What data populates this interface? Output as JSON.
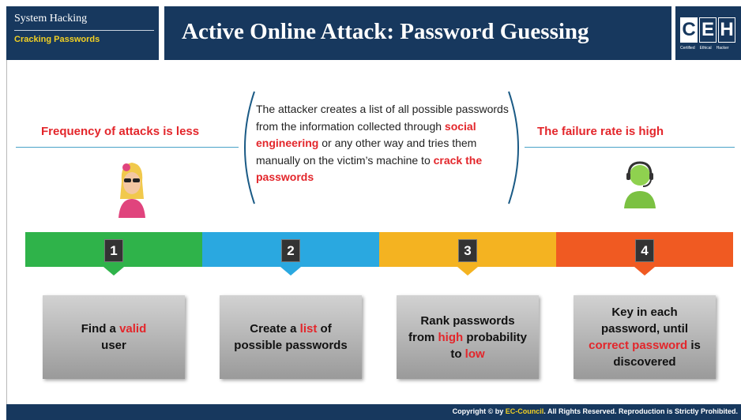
{
  "header": {
    "section": "System Hacking",
    "subsection": "Cracking Passwords",
    "title": "Active Online Attack: Password Guessing",
    "logo": {
      "letters": [
        "C",
        "E",
        "H"
      ],
      "tagline": [
        "Certified",
        "Ethical",
        "Hacker"
      ]
    }
  },
  "left_label": "Frequency of attacks is less",
  "right_label": "The failure rate is high",
  "description": {
    "p1": "The attacker creates a list of all possible passwords from the information collected through ",
    "highlight1": "social engineering",
    "p2": " or any other way and tries them manually on the victim’s machine to ",
    "highlight2": "crack the passwords"
  },
  "steps": [
    {
      "number": "1",
      "color": "#2fb34a",
      "pre": "Find a ",
      "hl": "valid",
      "post": " user"
    },
    {
      "number": "2",
      "color": "#2aa8e0",
      "pre": "Create a ",
      "hl": "list",
      "post": " of possible passwords"
    },
    {
      "number": "3",
      "color": "#f4b321",
      "pre": "Rank passwords from ",
      "hl": "high",
      "mid": " probability to ",
      "hl2": "low"
    },
    {
      "number": "4",
      "color": "#f05a22",
      "pre": "Key in each password, until ",
      "hl": "correct password",
      "post": " is discovered"
    }
  ],
  "footer": {
    "pre": "Copyright © by ",
    "brand": "EC-Council",
    "post": ". All Rights Reserved. Reproduction is Strictly Prohibited."
  },
  "icons": {
    "attacker": "woman-sunglasses-icon",
    "support": "headset-user-icon"
  }
}
